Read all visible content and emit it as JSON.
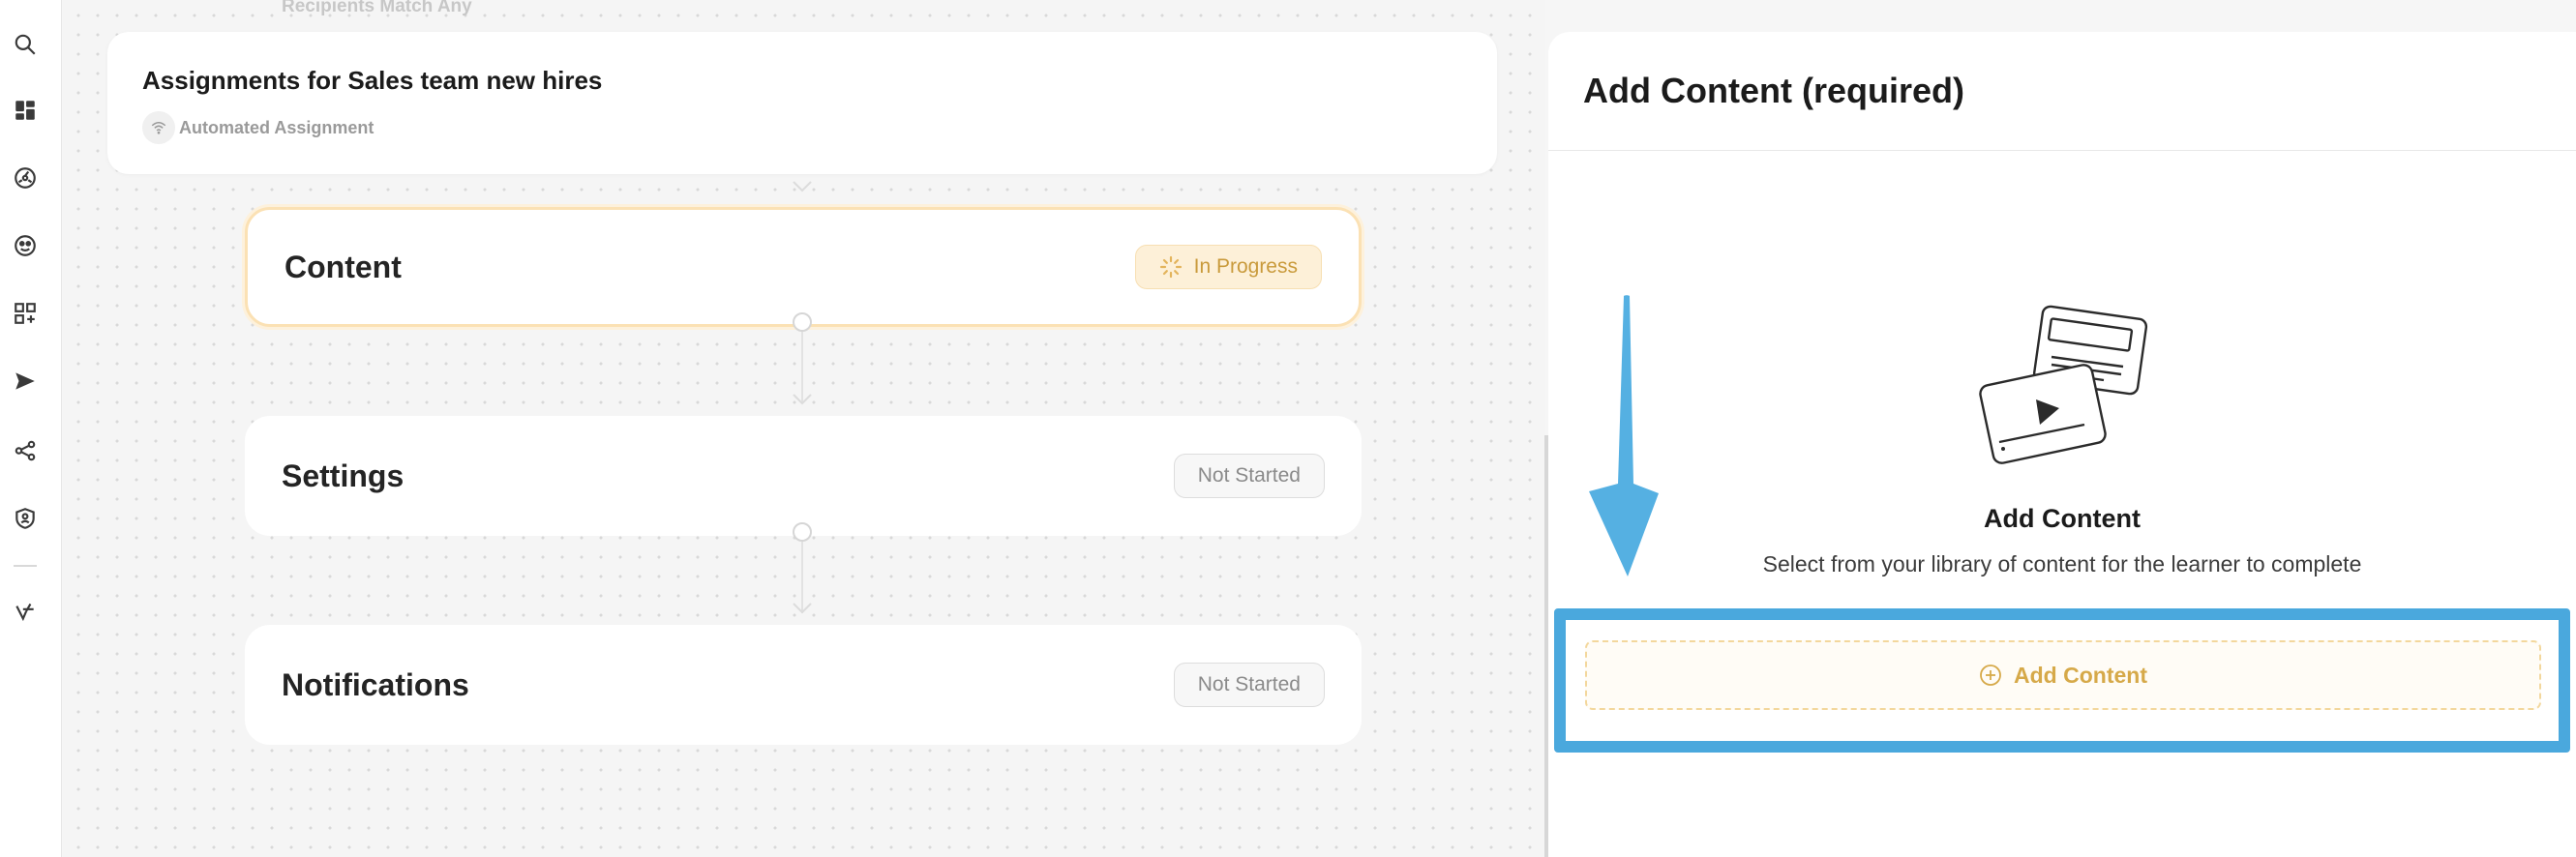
{
  "sidebar": {
    "icons": [
      "search-icon",
      "dashboard-icon",
      "dial-icon",
      "masks-icon",
      "apps-add-icon",
      "send-icon",
      "share-icon",
      "shield-user-icon",
      "logo-icon"
    ]
  },
  "canvas": {
    "ghost_label": "Recipients Match Any",
    "assignment": {
      "title": "Assignments for Sales team new hires",
      "type_label": "Automated Assignment"
    },
    "steps": [
      {
        "title": "Content",
        "status": "In Progress"
      },
      {
        "title": "Settings",
        "status": "Not Started"
      },
      {
        "title": "Notifications",
        "status": "Not Started"
      }
    ]
  },
  "panel": {
    "title": "Add Content (required)",
    "empty_title": "Add Content",
    "empty_description": "Select from your library of content for the learner to complete",
    "add_button_label": "Add Content"
  },
  "colors": {
    "accent": "#d6a949",
    "progress_bg": "#fdf0d8",
    "annotation": "#4aa8dd"
  }
}
